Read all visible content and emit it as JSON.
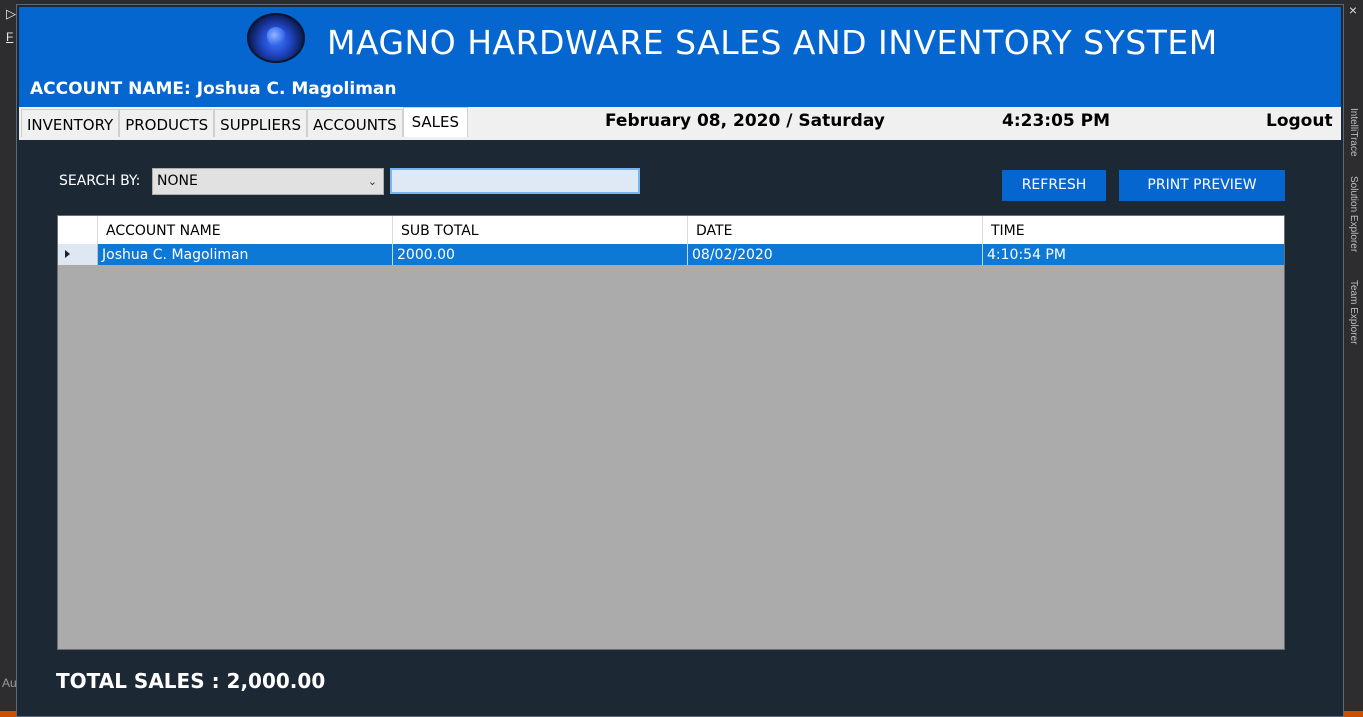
{
  "ide": {
    "left_top": "▷",
    "left_menu": "F",
    "left_bottom": "Au",
    "right_close": "×",
    "side_tabs": [
      "IntelliTrace",
      "Solution Explorer",
      "Team Explorer"
    ]
  },
  "header": {
    "title": "MAGNO HARDWARE SALES AND INVENTORY SYSTEM",
    "account_prefix": "ACCOUNT NAME: ",
    "account_name": "Joshua C. Magoliman"
  },
  "tabs": [
    {
      "label": "INVENTORY",
      "active": false
    },
    {
      "label": "PRODUCTS",
      "active": false
    },
    {
      "label": "SUPPLIERS",
      "active": false
    },
    {
      "label": "ACCOUNTS",
      "active": false
    },
    {
      "label": "SALES",
      "active": true
    }
  ],
  "statusbar": {
    "date": "February 08, 2020 / Saturday",
    "time": "4:23:05 PM",
    "logout": "Logout"
  },
  "search": {
    "label": "SEARCH BY:",
    "selected": "NONE",
    "text_value": ""
  },
  "buttons": {
    "refresh": "REFRESH",
    "print_preview": "PRINT PREVIEW"
  },
  "table": {
    "columns": [
      "ACCOUNT NAME",
      "SUB TOTAL",
      "DATE",
      "TIME"
    ],
    "rows": [
      [
        "Joshua C. Magoliman",
        "2000.00",
        "08/02/2020",
        "4:10:54 PM"
      ]
    ]
  },
  "footer": {
    "total_label": "TOTAL SALES : 2,000.00"
  },
  "colors": {
    "header_blue": "#0566cf",
    "panel_bg": "#1d2835",
    "selected_row": "#0e78d7",
    "grid_bg": "#ababab"
  }
}
